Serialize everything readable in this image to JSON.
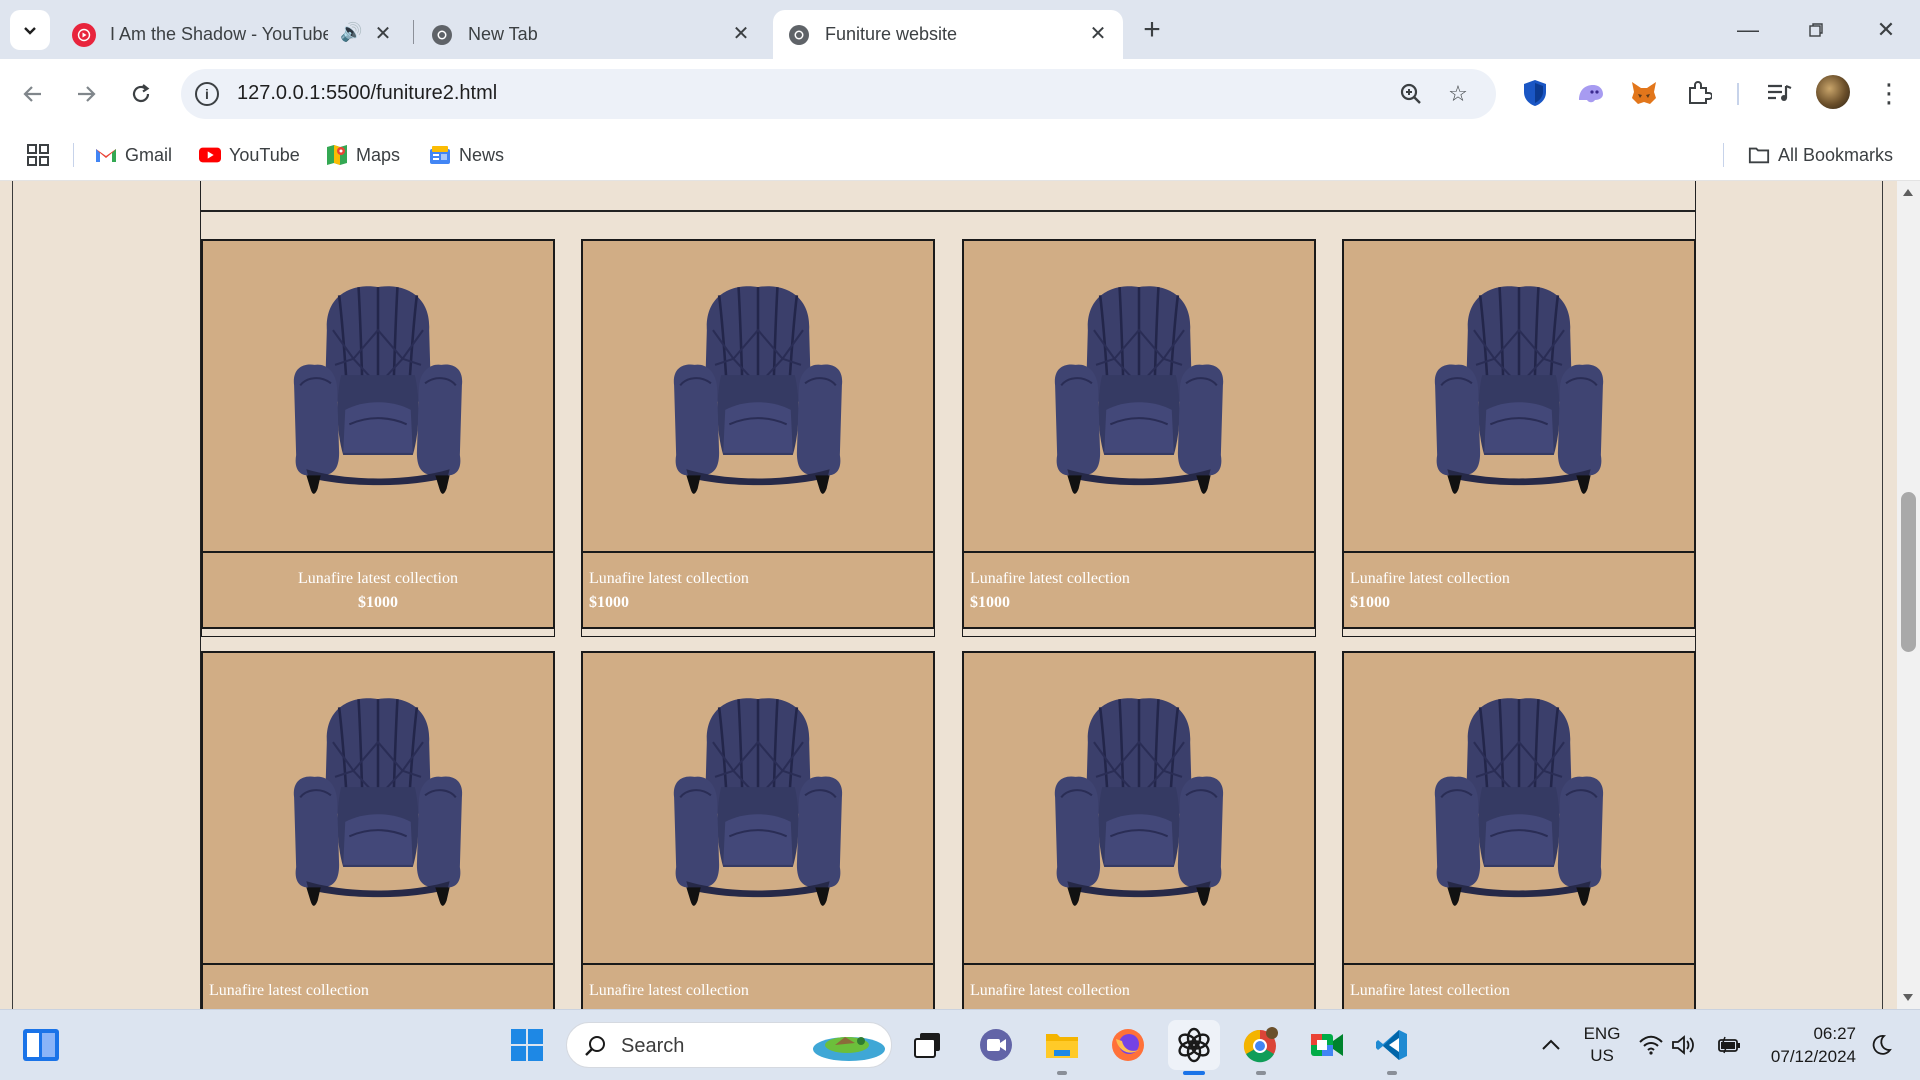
{
  "browser": {
    "tabs": [
      {
        "title": "I Am the Shadow - YouTube",
        "audio": true,
        "active": false
      },
      {
        "title": "New Tab",
        "active": false
      },
      {
        "title": "Funiture website",
        "active": true
      }
    ],
    "url": "127.0.0.1:5500/funiture2.html",
    "bookmarks": [
      {
        "label": "Gmail"
      },
      {
        "label": "YouTube"
      },
      {
        "label": "Maps"
      },
      {
        "label": "News"
      }
    ],
    "all_bookmarks_label": "All Bookmarks"
  },
  "page": {
    "rows": [
      [
        {
          "name": "Lunafire latest collection",
          "price": "$1000",
          "align": "center"
        },
        {
          "name": "Lunafire latest collection",
          "price": "$1000",
          "align": "left"
        },
        {
          "name": "Lunafire latest collection",
          "price": "$1000",
          "align": "left"
        },
        {
          "name": "Lunafire latest collection",
          "price": "$1000",
          "align": "left"
        }
      ],
      [
        {
          "name": "Lunafire latest collection",
          "align": "left"
        },
        {
          "name": "Lunafire latest collection",
          "align": "left"
        },
        {
          "name": "Lunafire latest collection",
          "align": "left"
        },
        {
          "name": "Lunafire latest collection",
          "align": "left"
        }
      ]
    ],
    "colors": {
      "background": "#ede2d4",
      "card": "#d1ad85",
      "chair": "#3b3f6b"
    }
  },
  "taskbar": {
    "search_label": "Search",
    "language": "ENG",
    "region": "US",
    "time": "06:27",
    "date": "07/12/2024"
  }
}
